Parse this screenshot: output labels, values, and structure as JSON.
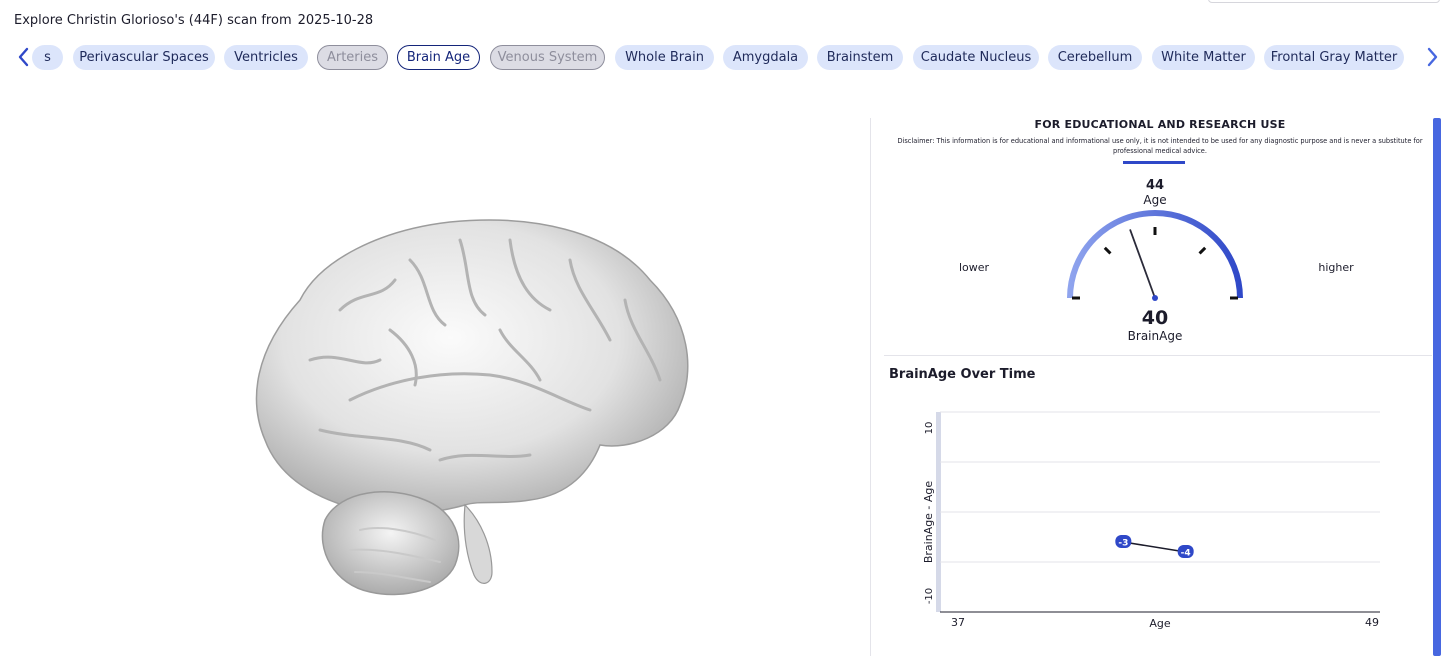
{
  "header": {
    "title": "Explore Christin Glorioso's (44F) scan from",
    "scan_date": "2025-10-28"
  },
  "nav": {
    "left_icon": "chevron-left-icon",
    "right_icon": "chevron-right-icon"
  },
  "tabs": [
    {
      "label": "s",
      "state": "normal"
    },
    {
      "label": "Perivascular Spaces",
      "state": "normal"
    },
    {
      "label": "Ventricles",
      "state": "normal"
    },
    {
      "label": "Arteries",
      "state": "disabled"
    },
    {
      "label": "Brain Age",
      "state": "active"
    },
    {
      "label": "Venous System",
      "state": "disabled"
    },
    {
      "label": "Whole Brain",
      "state": "normal"
    },
    {
      "label": "Amygdala",
      "state": "normal"
    },
    {
      "label": "Brainstem",
      "state": "normal"
    },
    {
      "label": "Caudate Nucleus",
      "state": "normal"
    },
    {
      "label": "Cerebellum",
      "state": "normal"
    },
    {
      "label": "White Matter",
      "state": "normal"
    },
    {
      "label": "Frontal Gray Matter",
      "state": "normal"
    }
  ],
  "panel": {
    "edu_title": "FOR EDUCATIONAL AND RESEARCH USE",
    "disclaimer": "Disclaimer: This information is for educational and informational use only, it is not intended to be used for any diagnostic purpose and is never a substitute for professional medical advice."
  },
  "gauge": {
    "age_value": "44",
    "age_label": "Age",
    "lower_label": "lower",
    "higher_label": "higher",
    "brainage_value": "40",
    "brainage_label": "BrainAge",
    "age": 44,
    "brainage": 40,
    "range_min": 26,
    "range_max": 62,
    "colors": {
      "arc_start": "#8fa4ee",
      "arc_end": "#2f48c8",
      "needle": "#2b2b3a",
      "tick": "#111111"
    }
  },
  "chart_data": {
    "type": "line",
    "title": "BrainAge Over Time",
    "xlabel": "Age",
    "ylabel": "BrainAge - Age",
    "xlim": [
      37,
      49
    ],
    "ylim": [
      -10,
      10
    ],
    "x_tick_labels": [
      "37",
      "49"
    ],
    "y_tick_labels": [
      "-10",
      "10"
    ],
    "grid": true,
    "series": [
      {
        "x": [
          42.0,
          43.7
        ],
        "y": [
          -3,
          -4
        ],
        "labels": [
          "-3",
          "-4"
        ],
        "color": "#2f48c8"
      }
    ]
  },
  "brain_render": {
    "icon": "brain-3d-model",
    "color": "#e8e8e8"
  }
}
